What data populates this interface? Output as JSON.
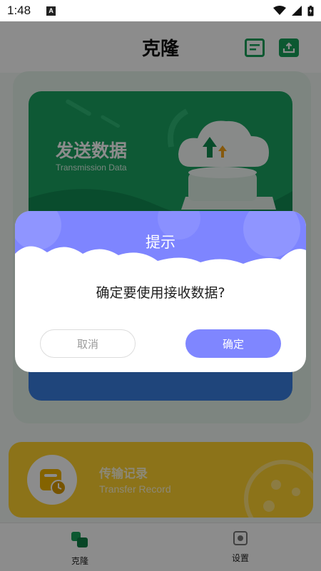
{
  "status_bar": {
    "time": "1:48",
    "notification_letter": "A"
  },
  "header": {
    "title": "克隆"
  },
  "send_card": {
    "title": "发送数据",
    "subtitle": "Transmission Data"
  },
  "record_card": {
    "title": "传输记录",
    "subtitle": "Transfer Record"
  },
  "bottom_nav": {
    "items": [
      {
        "label": "克隆"
      },
      {
        "label": "设置"
      }
    ]
  },
  "dialog": {
    "title": "提示",
    "message": "确定要使用接收数据?",
    "cancel_label": "取消",
    "confirm_label": "确定"
  },
  "colors": {
    "brand_green": "#17a05a",
    "dialog_accent": "#7f86ff",
    "record_yellow": "#ffd22e",
    "receive_blue": "#3a7fe0"
  }
}
